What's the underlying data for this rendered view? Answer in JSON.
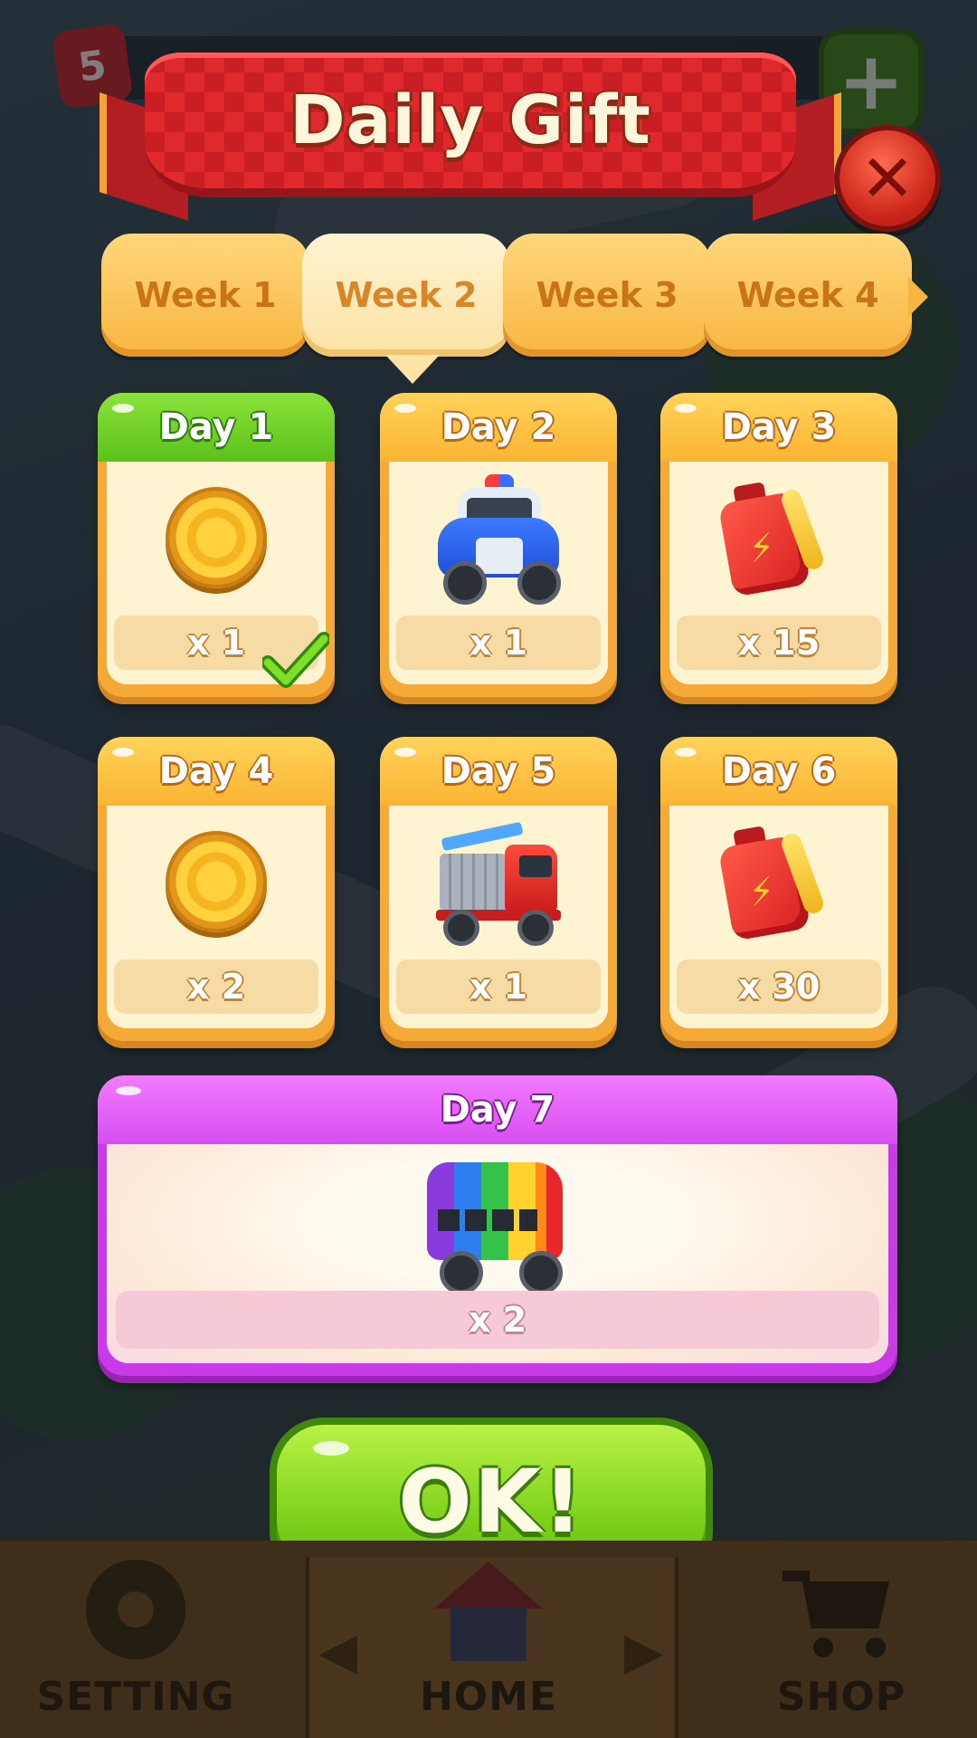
{
  "header": {
    "title": "Daily Gift",
    "lives_count": "5"
  },
  "tabs": [
    {
      "label": "Week 1",
      "active": false
    },
    {
      "label": "Week 2",
      "active": true
    },
    {
      "label": "Week 3",
      "active": false
    },
    {
      "label": "Week 4",
      "active": false
    }
  ],
  "days": [
    {
      "label": "Day 1",
      "reward_icon": "coin-icon",
      "quantity": "x 1",
      "claimed": true
    },
    {
      "label": "Day 2",
      "reward_icon": "police-car-icon",
      "quantity": "x 1",
      "claimed": false
    },
    {
      "label": "Day 3",
      "reward_icon": "fuel-can-icon",
      "quantity": "x 15",
      "claimed": false
    },
    {
      "label": "Day 4",
      "reward_icon": "coin-icon",
      "quantity": "x 2",
      "claimed": false
    },
    {
      "label": "Day 5",
      "reward_icon": "fire-truck-icon",
      "quantity": "x 1",
      "claimed": false
    },
    {
      "label": "Day 6",
      "reward_icon": "fuel-can-icon",
      "quantity": "x 30",
      "claimed": false
    },
    {
      "label": "Day 7",
      "reward_icon": "rainbow-bus-icon",
      "quantity": "x 2",
      "claimed": false
    }
  ],
  "ok_button": {
    "label": "OK!"
  },
  "bottom_nav": [
    {
      "label": "SETTING",
      "icon": "gear-icon"
    },
    {
      "label": "HOME",
      "icon": "home-icon"
    },
    {
      "label": "SHOP",
      "icon": "cart-icon"
    }
  ],
  "colors": {
    "banner_red": "#e0292d",
    "tab_orange": "#f8b640",
    "card_orange": "#f5a936",
    "claimed_green": "#5cc11a",
    "day7_purple": "#c93be6",
    "ok_green": "#7fd21c"
  }
}
